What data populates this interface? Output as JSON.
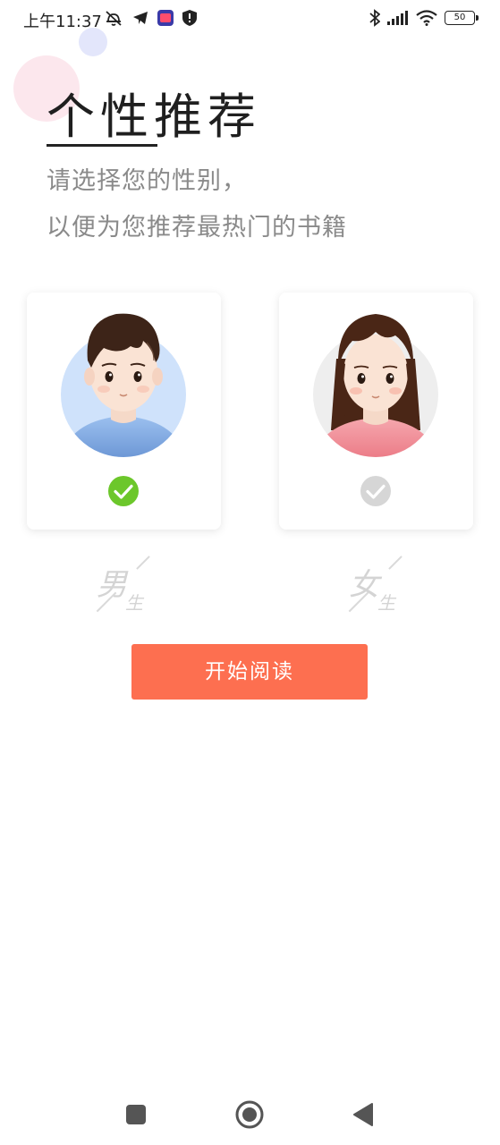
{
  "status_bar": {
    "time": "上午11:37",
    "battery_level": "50",
    "icons": [
      "alarm-off-icon",
      "telegram-icon",
      "app-badge-icon",
      "shield-icon",
      "bluetooth-icon",
      "signal-icon",
      "wifi-icon",
      "battery-icon"
    ]
  },
  "header": {
    "title": "个性推荐",
    "subtitle_line1": "请选择您的性别，",
    "subtitle_line2": "以便为您推荐最热门的书籍"
  },
  "gender_options": [
    {
      "label_main": "男",
      "label_sub": "生",
      "selected": true,
      "avatar": "boy-avatar",
      "check_color": "#6cc72b"
    },
    {
      "label_main": "女",
      "label_sub": "生",
      "selected": false,
      "avatar": "girl-avatar",
      "check_color": "#d6d6d6"
    }
  ],
  "start_button": {
    "label": "开始阅读",
    "color": "#fd6f50"
  },
  "nav_bar": {
    "icons": [
      "recents-icon",
      "home-icon",
      "back-icon"
    ]
  }
}
